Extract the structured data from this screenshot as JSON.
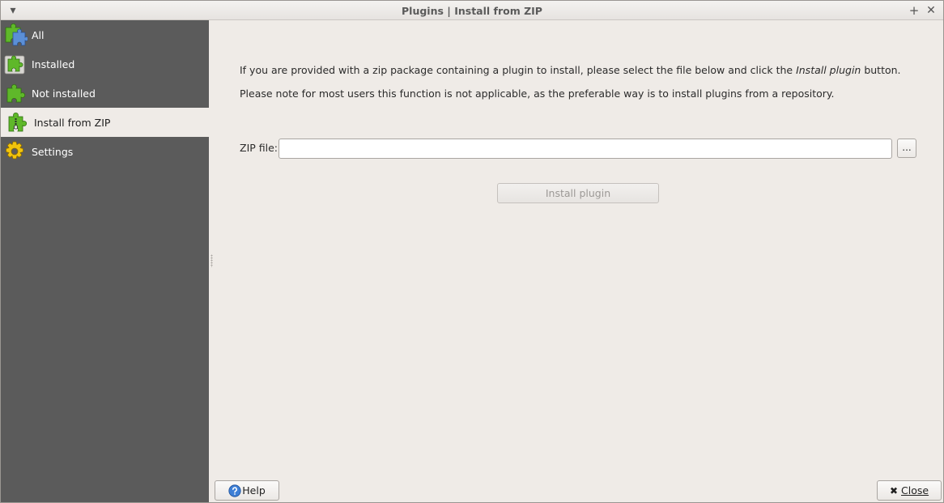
{
  "window": {
    "title": "Plugins | Install from ZIP",
    "menu_glyph": "▾",
    "maximize_glyph": "+",
    "close_glyph": "✕"
  },
  "sidebar": {
    "items": [
      {
        "label": "All",
        "icon": "puzzle-all-icon",
        "active": false
      },
      {
        "label": "Installed",
        "icon": "puzzle-installed-icon",
        "active": false
      },
      {
        "label": "Not installed",
        "icon": "puzzle-not-installed-icon",
        "active": false
      },
      {
        "label": "Install from ZIP",
        "icon": "puzzle-zip-icon",
        "active": true
      },
      {
        "label": "Settings",
        "icon": "gear-icon",
        "active": false
      }
    ]
  },
  "main": {
    "intro_prefix": "If you are provided with a zip package containing a plugin to install, please select the file below and click the ",
    "intro_emphasis": "Install plugin",
    "intro_suffix": " button.",
    "note": "Please note for most users this function is not applicable, as the preferable way is to install plugins from a repository.",
    "zip_label": "ZIP file:",
    "zip_value": "",
    "browse_label": "...",
    "install_label": "Install plugin",
    "install_enabled": false
  },
  "footer": {
    "help_label": "Help",
    "close_glyph": "✖",
    "close_label": "Close"
  },
  "colors": {
    "sidebar_bg": "#5b5b5b",
    "content_bg": "#efebe7",
    "puzzle_green": "#5fb82a",
    "puzzle_blue": "#5b8fd6",
    "gear_yellow": "#f2c40c"
  }
}
